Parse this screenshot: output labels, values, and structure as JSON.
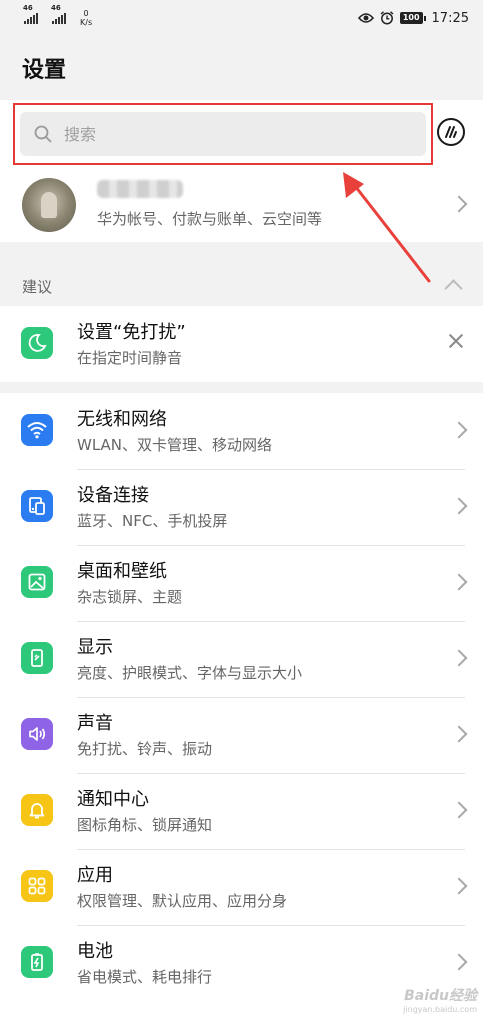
{
  "status_bar": {
    "signal1": "46",
    "signal2": "46",
    "net_speed_value": "0",
    "net_speed_unit": "K/s",
    "battery": "100",
    "time": "17:25",
    "icons": [
      "eye-icon",
      "alarm-icon",
      "battery-icon"
    ]
  },
  "page": {
    "title": "设置"
  },
  "search": {
    "placeholder": "搜索",
    "value": ""
  },
  "account": {
    "subtitle": "华为帐号、付款与账单、云空间等"
  },
  "suggestions": {
    "label": "建议",
    "item": {
      "title": "设置“免打扰”",
      "subtitle": "在指定时间静音",
      "icon": "moon-icon",
      "color": "#2ec87a"
    }
  },
  "settings": [
    {
      "title": "无线和网络",
      "subtitle": "WLAN、双卡管理、移动网络",
      "icon": "wifi-icon",
      "color": "#2a7cf0"
    },
    {
      "title": "设备连接",
      "subtitle": "蓝牙、NFC、手机投屏",
      "icon": "device-connect-icon",
      "color": "#2a7cf0"
    },
    {
      "title": "桌面和壁纸",
      "subtitle": "杂志锁屏、主题",
      "icon": "wallpaper-icon",
      "color": "#2ec87a"
    },
    {
      "title": "显示",
      "subtitle": "亮度、护眼模式、字体与显示大小",
      "icon": "display-icon",
      "color": "#2ec87a"
    },
    {
      "title": "声音",
      "subtitle": "免打扰、铃声、振动",
      "icon": "sound-icon",
      "color": "#8e63e6"
    },
    {
      "title": "通知中心",
      "subtitle": "图标角标、锁屏通知",
      "icon": "bell-icon",
      "color": "#f6c515"
    },
    {
      "title": "应用",
      "subtitle": "权限管理、默认应用、应用分身",
      "icon": "apps-icon",
      "color": "#f6c515"
    },
    {
      "title": "电池",
      "subtitle": "省电模式、耗电排行",
      "icon": "battery-charge-icon",
      "color": "#2ec87a"
    }
  ],
  "watermark": {
    "brand": "Baidu经验",
    "url": "jingyan.baidu.com"
  }
}
